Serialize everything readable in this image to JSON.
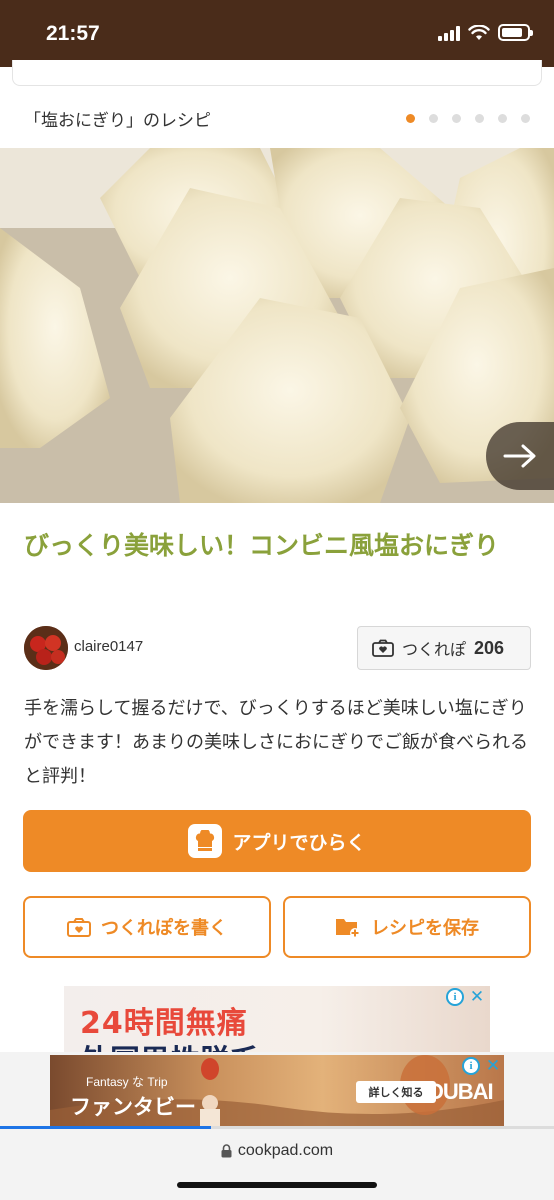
{
  "status_bar": {
    "time": "21:57",
    "battery_level": 0.85
  },
  "section": {
    "title": "「塩おにぎり」のレシピ",
    "carousel_pages": 6,
    "active_page": 1
  },
  "recipe": {
    "title": "びっくり美味しい！コンビニ風塩おにぎり",
    "author": "claire0147",
    "tsukurepo_label": "つくれぽ",
    "tsukurepo_count": "206",
    "description": "手を濡らして握るだけで、びっくりするほど美味しい塩にぎりができます！あまりの美味しさにおにぎりでご飯が食べられると評判！"
  },
  "actions": {
    "open_app": "アプリでひらく",
    "write_tsukurepo": "つくれぽを書く",
    "save_recipe": "レシピを保存"
  },
  "ads": {
    "ad1_line1": "24時間無痛",
    "ad1_line2": "外国男性脱毛",
    "ad2_small": "Fantasy な Trip",
    "ad2_main": "ファンタビー",
    "ad2_button": "詳しく知る",
    "ad2_brand": "DUBAI"
  },
  "browser": {
    "url": "cookpad.com",
    "load_progress": 0.38
  },
  "colors": {
    "accent": "#ee8a26",
    "title_green": "#8aa13b",
    "status_bar": "#4a2c1a"
  }
}
